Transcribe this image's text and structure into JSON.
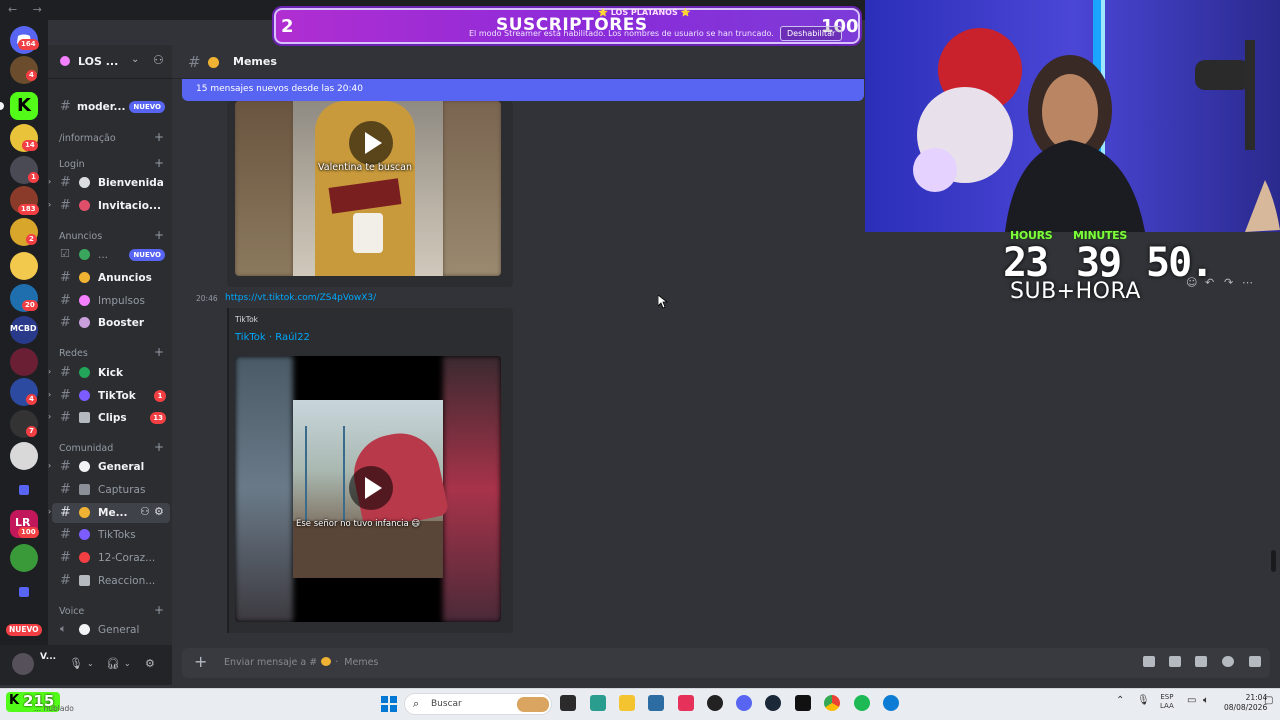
{
  "server_rail": {
    "badges": [
      "164",
      "4",
      "14",
      "1",
      "183",
      "2",
      "4",
      "20",
      "4",
      "7",
      "100"
    ],
    "nuevo_label": "NUEVO"
  },
  "guild": {
    "name": "LOS ..."
  },
  "sidebar": {
    "top_channel": {
      "label": "moder...",
      "tag": "NUEVO"
    },
    "categories": [
      {
        "label": "/informação"
      },
      {
        "label": "Login"
      },
      {
        "label": "Anuncios"
      },
      {
        "label": "Redes"
      },
      {
        "label": "Comunidad"
      },
      {
        "label": "Voice"
      }
    ],
    "channels": [
      {
        "label": "Bienvenida"
      },
      {
        "label": "Invitacio..."
      },
      {
        "label": "...",
        "tag": "NUEVO"
      },
      {
        "label": "Anuncios"
      },
      {
        "label": "Impulsos"
      },
      {
        "label": "Booster"
      },
      {
        "label": "Kick"
      },
      {
        "label": "TikTok",
        "badge": "1"
      },
      {
        "label": "Clips",
        "badge": "13"
      },
      {
        "label": "General"
      },
      {
        "label": "Capturas"
      },
      {
        "label": "Me..."
      },
      {
        "label": "TikToks"
      },
      {
        "label": "12-Coraz..."
      },
      {
        "label": "Reaccion..."
      },
      {
        "label": "General"
      }
    ]
  },
  "user_panel": {
    "name": "V..."
  },
  "chat": {
    "channel_name": "Memes",
    "new_messages_banner": "15 mensajes nuevos desde las 20:40",
    "video1_caption": "Valentina te buscan",
    "message": {
      "time": "20:46",
      "link": "https://vt.tiktok.com/ZS4pVowX3/",
      "embed_provider": "TikTok",
      "embed_title": "TikTok · Raúl22",
      "video_caption": "Ese señor no tuvo infancia 😄"
    },
    "composer_placeholder": "Enviar mensaje a #",
    "composer_channel": "Memes"
  },
  "stream_overlay": {
    "subs_left": "2",
    "subs_title": "SUSCRIPTORES",
    "subs_right": "100",
    "subs_top_text": "⭐ LOS PLATANOS ⭐",
    "streamer_notice": "El modo Streamer está habilitado. Los nombres de usuario se han truncado.",
    "disable_button": "Deshabilitar",
    "hours_label": "HOURS",
    "minutes_label": "MINUTES",
    "hours_value": "23",
    "minutes_value": "39",
    "seconds_value": "50.",
    "sub_hora": "SUB+HORA"
  },
  "taskbar": {
    "kick_count": "215",
    "kick_sub": "... nublado",
    "search_label": "Buscar",
    "lang_top": "ESP",
    "lang_bottom": "LAA",
    "time": "21:04",
    "date": "08/08/2026"
  },
  "colors": {
    "discord_bg": "#313338",
    "sidebar_bg": "#2b2d31",
    "rail_bg": "#1e1f22",
    "blurple": "#5865f2",
    "link": "#00a8fc",
    "kick_green": "#53fc18"
  }
}
